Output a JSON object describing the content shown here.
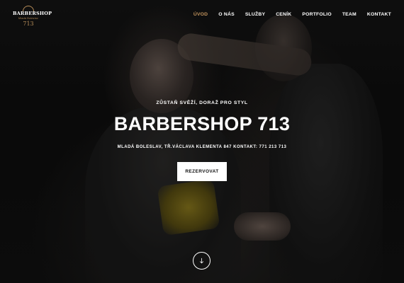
{
  "brand": {
    "name": "BARBERSHOP",
    "tagline": "Mladá Boleslav",
    "number": "713"
  },
  "nav": {
    "items": [
      {
        "label": "ÚVOD",
        "active": true
      },
      {
        "label": "O NÁS",
        "active": false
      },
      {
        "label": "SLUŽBY",
        "active": false
      },
      {
        "label": "CENÍK",
        "active": false
      },
      {
        "label": "PORTFOLIO",
        "active": false
      },
      {
        "label": "TEAM",
        "active": false
      },
      {
        "label": "KONTAKT",
        "active": false
      }
    ]
  },
  "hero": {
    "tagline": "ZŮSTAŇ SVĚŽÍ, DORAŽ PRO STYL",
    "title": "BARBERSHOP 713",
    "address": "MLADÁ BOLESLAV, TŘ.VÁCLAVA KLEMENTA 847 KONTAKT: 771 213 713",
    "cta_label": "REZERVOVAT",
    "scroll_icon": "arrow-down-icon"
  },
  "colors": {
    "accent": "#c4955e",
    "background": "#0c0c0c",
    "button_bg": "#ffffff"
  }
}
